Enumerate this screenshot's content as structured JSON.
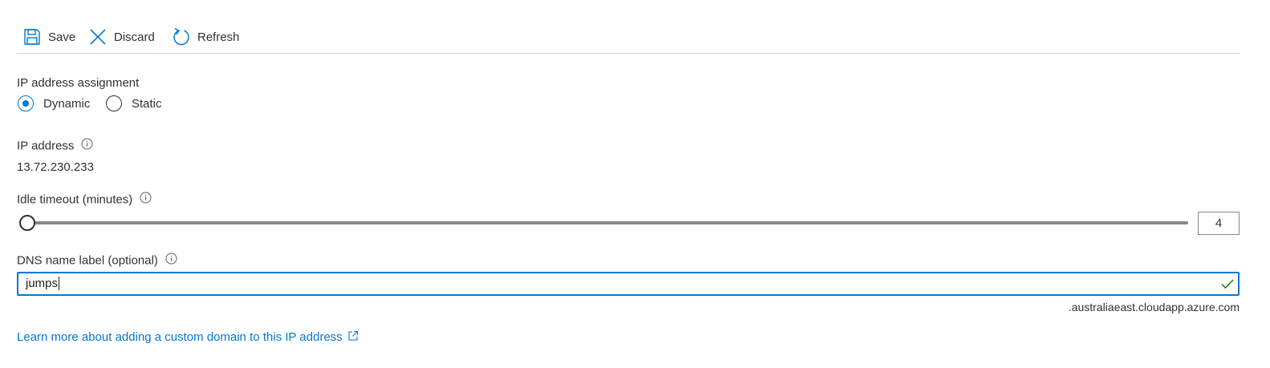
{
  "toolbar": {
    "save_label": "Save",
    "discard_label": "Discard",
    "refresh_label": "Refresh",
    "save_icon": "save-icon",
    "discard_icon": "close-icon",
    "refresh_icon": "refresh-icon"
  },
  "assignment": {
    "label": "IP address assignment",
    "options": [
      {
        "label": "Dynamic",
        "selected": true
      },
      {
        "label": "Static",
        "selected": false
      }
    ]
  },
  "ip_address": {
    "label": "IP address",
    "value": "13.72.230.233"
  },
  "idle_timeout": {
    "label": "Idle timeout (minutes)",
    "value": "4",
    "min": 4,
    "max": 30
  },
  "dns": {
    "label": "DNS name label (optional)",
    "value": "jumps",
    "suffix": ".australiaeast.cloudapp.azure.com",
    "valid": true
  },
  "learn_more": {
    "text": "Learn more about adding a custom domain to this IP address"
  },
  "colors": {
    "accent": "#0078d4",
    "success": "#107c10",
    "text": "#323130",
    "border": "#8a8886"
  }
}
